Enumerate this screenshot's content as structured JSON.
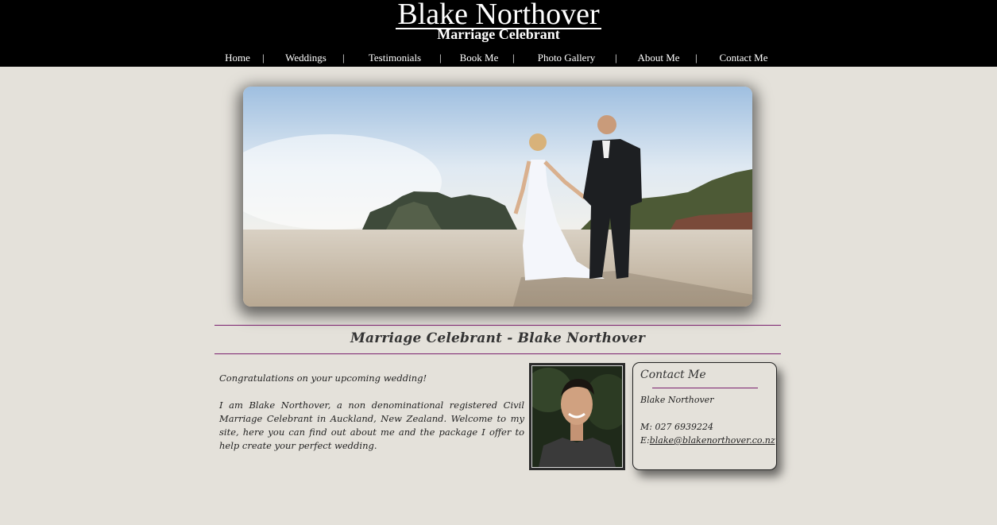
{
  "header": {
    "title": "Blake Northover",
    "subtitle": "Marriage Celebrant"
  },
  "nav": {
    "items": [
      {
        "label": "Home"
      },
      {
        "label": "Weddings"
      },
      {
        "label": "Testimonials"
      },
      {
        "label": "Book Me"
      },
      {
        "label": "Photo Gallery"
      },
      {
        "label": "About Me"
      },
      {
        "label": "Contact Me"
      }
    ],
    "separator": "|"
  },
  "main": {
    "heading": "Marriage Celebrant - Blake Northover",
    "intro": [
      "Congratulations on your upcoming wedding!",
      "I am Blake Northover, a non denominational registered Civil Marriage Celebrant in Auckland, New Zealand. Welcome to my site, here you can find out about me and the package I offer to help create your perfect wedding."
    ]
  },
  "contact": {
    "title": "Contact Me",
    "name": "Blake Northover",
    "mobile": "M: 027 6939224",
    "email_prefix": "E:",
    "email": "blake@blakenorthover.co.nz"
  },
  "colors": {
    "header_bg": "#000000",
    "page_bg": "#e4e1da",
    "accent_rule": "#7a1f6e"
  }
}
